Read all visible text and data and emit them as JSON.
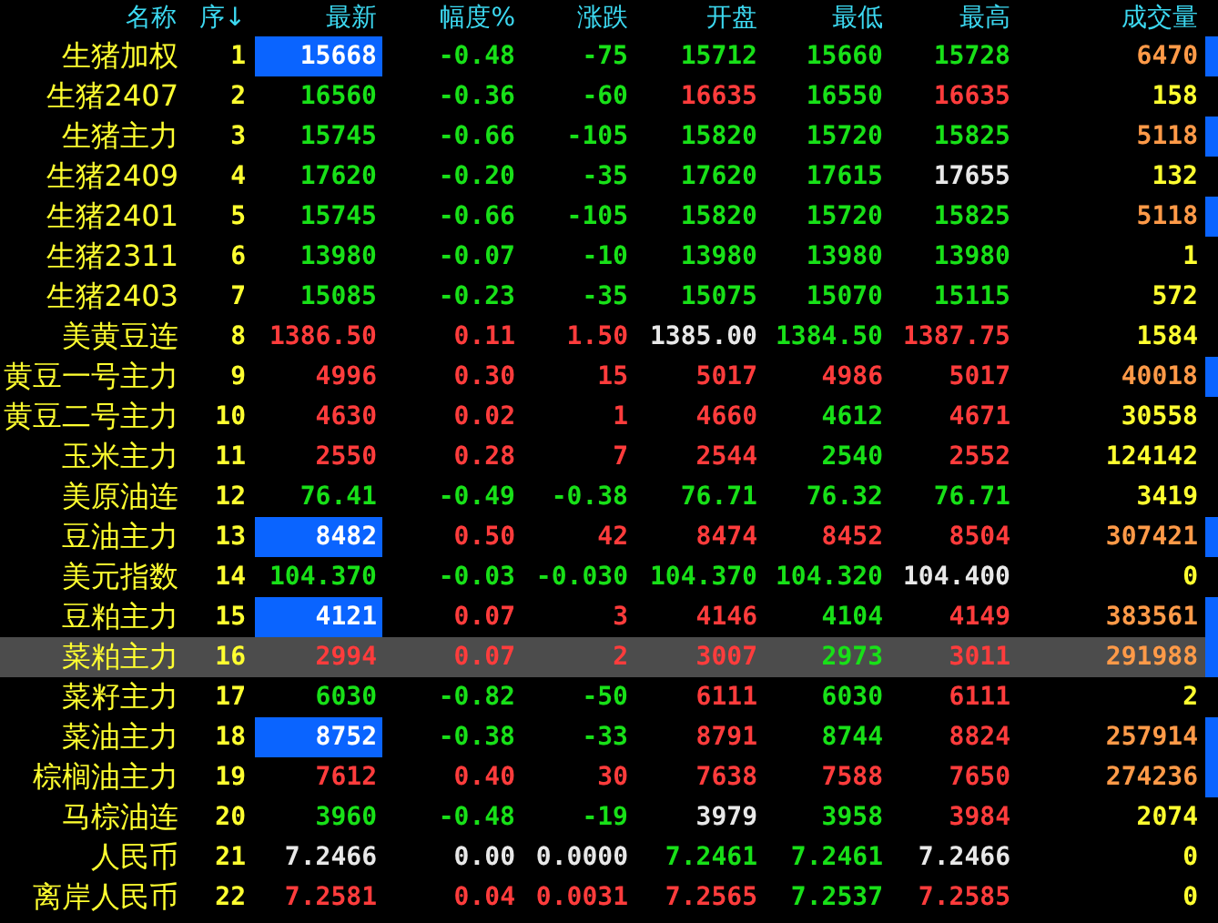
{
  "table": {
    "columns": [
      {
        "label": "名称"
      },
      {
        "label": "序↓"
      },
      {
        "label": "最新"
      },
      {
        "label": "幅度%"
      },
      {
        "label": "涨跌"
      },
      {
        "label": "开盘"
      },
      {
        "label": "最低"
      },
      {
        "label": "最高"
      },
      {
        "label": "成交量"
      }
    ],
    "rows": [
      {
        "selected": false,
        "highlighted": true,
        "marked": true,
        "cells": [
          {
            "text": "生猪加权",
            "color": "#ffff30"
          },
          {
            "text": "1",
            "color": "#ffff30"
          },
          {
            "text": "15668",
            "color": "#ffffff"
          },
          {
            "text": "-0.48",
            "color": "#18e018"
          },
          {
            "text": "-75",
            "color": "#18e018"
          },
          {
            "text": "15712",
            "color": "#18e018"
          },
          {
            "text": "15660",
            "color": "#18e018"
          },
          {
            "text": "15728",
            "color": "#18e018"
          },
          {
            "text": "6470",
            "color": "#ff9a48"
          }
        ]
      },
      {
        "selected": false,
        "highlighted": false,
        "marked": false,
        "cells": [
          {
            "text": "生猪2407",
            "color": "#ffff30"
          },
          {
            "text": "2",
            "color": "#ffff30"
          },
          {
            "text": "16560",
            "color": "#18e018"
          },
          {
            "text": "-0.36",
            "color": "#18e018"
          },
          {
            "text": "-60",
            "color": "#18e018"
          },
          {
            "text": "16635",
            "color": "#ff3c3c"
          },
          {
            "text": "16550",
            "color": "#18e018"
          },
          {
            "text": "16635",
            "color": "#ff3c3c"
          },
          {
            "text": "158",
            "color": "#ffff30"
          }
        ]
      },
      {
        "selected": false,
        "highlighted": false,
        "marked": true,
        "cells": [
          {
            "text": "生猪主力",
            "color": "#ffff30"
          },
          {
            "text": "3",
            "color": "#ffff30"
          },
          {
            "text": "15745",
            "color": "#18e018"
          },
          {
            "text": "-0.66",
            "color": "#18e018"
          },
          {
            "text": "-105",
            "color": "#18e018"
          },
          {
            "text": "15820",
            "color": "#18e018"
          },
          {
            "text": "15720",
            "color": "#18e018"
          },
          {
            "text": "15825",
            "color": "#18e018"
          },
          {
            "text": "5118",
            "color": "#ff9a48"
          }
        ]
      },
      {
        "selected": false,
        "highlighted": false,
        "marked": false,
        "cells": [
          {
            "text": "生猪2409",
            "color": "#ffff30"
          },
          {
            "text": "4",
            "color": "#ffff30"
          },
          {
            "text": "17620",
            "color": "#18e018"
          },
          {
            "text": "-0.20",
            "color": "#18e018"
          },
          {
            "text": "-35",
            "color": "#18e018"
          },
          {
            "text": "17620",
            "color": "#18e018"
          },
          {
            "text": "17615",
            "color": "#18e018"
          },
          {
            "text": "17655",
            "color": "#e8e8e8"
          },
          {
            "text": "132",
            "color": "#ffff30"
          }
        ]
      },
      {
        "selected": false,
        "highlighted": false,
        "marked": true,
        "cells": [
          {
            "text": "生猪2401",
            "color": "#ffff30"
          },
          {
            "text": "5",
            "color": "#ffff30"
          },
          {
            "text": "15745",
            "color": "#18e018"
          },
          {
            "text": "-0.66",
            "color": "#18e018"
          },
          {
            "text": "-105",
            "color": "#18e018"
          },
          {
            "text": "15820",
            "color": "#18e018"
          },
          {
            "text": "15720",
            "color": "#18e018"
          },
          {
            "text": "15825",
            "color": "#18e018"
          },
          {
            "text": "5118",
            "color": "#ff9a48"
          }
        ]
      },
      {
        "selected": false,
        "highlighted": false,
        "marked": false,
        "cells": [
          {
            "text": "生猪2311",
            "color": "#ffff30"
          },
          {
            "text": "6",
            "color": "#ffff30"
          },
          {
            "text": "13980",
            "color": "#18e018"
          },
          {
            "text": "-0.07",
            "color": "#18e018"
          },
          {
            "text": "-10",
            "color": "#18e018"
          },
          {
            "text": "13980",
            "color": "#18e018"
          },
          {
            "text": "13980",
            "color": "#18e018"
          },
          {
            "text": "13980",
            "color": "#18e018"
          },
          {
            "text": "1",
            "color": "#ffff30"
          }
        ]
      },
      {
        "selected": false,
        "highlighted": false,
        "marked": false,
        "cells": [
          {
            "text": "生猪2403",
            "color": "#ffff30"
          },
          {
            "text": "7",
            "color": "#ffff30"
          },
          {
            "text": "15085",
            "color": "#18e018"
          },
          {
            "text": "-0.23",
            "color": "#18e018"
          },
          {
            "text": "-35",
            "color": "#18e018"
          },
          {
            "text": "15075",
            "color": "#18e018"
          },
          {
            "text": "15070",
            "color": "#18e018"
          },
          {
            "text": "15115",
            "color": "#18e018"
          },
          {
            "text": "572",
            "color": "#ffff30"
          }
        ]
      },
      {
        "selected": false,
        "highlighted": false,
        "marked": false,
        "cells": [
          {
            "text": "美黄豆连",
            "color": "#ffff30"
          },
          {
            "text": "8",
            "color": "#ffff30"
          },
          {
            "text": "1386.50",
            "color": "#ff3c3c"
          },
          {
            "text": "0.11",
            "color": "#ff3c3c"
          },
          {
            "text": "1.50",
            "color": "#ff3c3c"
          },
          {
            "text": "1385.00",
            "color": "#e8e8e8"
          },
          {
            "text": "1384.50",
            "color": "#18e018"
          },
          {
            "text": "1387.75",
            "color": "#ff3c3c"
          },
          {
            "text": "1584",
            "color": "#ffff30"
          }
        ]
      },
      {
        "selected": false,
        "highlighted": false,
        "marked": true,
        "cells": [
          {
            "text": "黄豆一号主力",
            "color": "#ffff30"
          },
          {
            "text": "9",
            "color": "#ffff30"
          },
          {
            "text": "4996",
            "color": "#ff3c3c"
          },
          {
            "text": "0.30",
            "color": "#ff3c3c"
          },
          {
            "text": "15",
            "color": "#ff3c3c"
          },
          {
            "text": "5017",
            "color": "#ff3c3c"
          },
          {
            "text": "4986",
            "color": "#ff3c3c"
          },
          {
            "text": "5017",
            "color": "#ff3c3c"
          },
          {
            "text": "40018",
            "color": "#ff9a48"
          }
        ]
      },
      {
        "selected": false,
        "highlighted": false,
        "marked": false,
        "cells": [
          {
            "text": "黄豆二号主力",
            "color": "#ffff30"
          },
          {
            "text": "10",
            "color": "#ffff30"
          },
          {
            "text": "4630",
            "color": "#ff3c3c"
          },
          {
            "text": "0.02",
            "color": "#ff3c3c"
          },
          {
            "text": "1",
            "color": "#ff3c3c"
          },
          {
            "text": "4660",
            "color": "#ff3c3c"
          },
          {
            "text": "4612",
            "color": "#18e018"
          },
          {
            "text": "4671",
            "color": "#ff3c3c"
          },
          {
            "text": "30558",
            "color": "#ffff30"
          }
        ]
      },
      {
        "selected": false,
        "highlighted": false,
        "marked": false,
        "cells": [
          {
            "text": "玉米主力",
            "color": "#ffff30"
          },
          {
            "text": "11",
            "color": "#ffff30"
          },
          {
            "text": "2550",
            "color": "#ff3c3c"
          },
          {
            "text": "0.28",
            "color": "#ff3c3c"
          },
          {
            "text": "7",
            "color": "#ff3c3c"
          },
          {
            "text": "2544",
            "color": "#ff3c3c"
          },
          {
            "text": "2540",
            "color": "#18e018"
          },
          {
            "text": "2552",
            "color": "#ff3c3c"
          },
          {
            "text": "124142",
            "color": "#ffff30"
          }
        ]
      },
      {
        "selected": false,
        "highlighted": false,
        "marked": false,
        "cells": [
          {
            "text": "美原油连",
            "color": "#ffff30"
          },
          {
            "text": "12",
            "color": "#ffff30"
          },
          {
            "text": "76.41",
            "color": "#18e018"
          },
          {
            "text": "-0.49",
            "color": "#18e018"
          },
          {
            "text": "-0.38",
            "color": "#18e018"
          },
          {
            "text": "76.71",
            "color": "#18e018"
          },
          {
            "text": "76.32",
            "color": "#18e018"
          },
          {
            "text": "76.71",
            "color": "#18e018"
          },
          {
            "text": "3419",
            "color": "#ffff30"
          }
        ]
      },
      {
        "selected": false,
        "highlighted": true,
        "marked": true,
        "cells": [
          {
            "text": "豆油主力",
            "color": "#ffff30"
          },
          {
            "text": "13",
            "color": "#ffff30"
          },
          {
            "text": "8482",
            "color": "#ffffff"
          },
          {
            "text": "0.50",
            "color": "#ff3c3c"
          },
          {
            "text": "42",
            "color": "#ff3c3c"
          },
          {
            "text": "8474",
            "color": "#ff3c3c"
          },
          {
            "text": "8452",
            "color": "#ff3c3c"
          },
          {
            "text": "8504",
            "color": "#ff3c3c"
          },
          {
            "text": "307421",
            "color": "#ff9a48"
          }
        ]
      },
      {
        "selected": false,
        "highlighted": false,
        "marked": false,
        "cells": [
          {
            "text": "美元指数",
            "color": "#ffff30"
          },
          {
            "text": "14",
            "color": "#ffff30"
          },
          {
            "text": "104.370",
            "color": "#18e018"
          },
          {
            "text": "-0.03",
            "color": "#18e018"
          },
          {
            "text": "-0.030",
            "color": "#18e018"
          },
          {
            "text": "104.370",
            "color": "#18e018"
          },
          {
            "text": "104.320",
            "color": "#18e018"
          },
          {
            "text": "104.400",
            "color": "#e8e8e8"
          },
          {
            "text": "0",
            "color": "#ffff30"
          }
        ]
      },
      {
        "selected": false,
        "highlighted": true,
        "marked": true,
        "cells": [
          {
            "text": "豆粕主力",
            "color": "#ffff30"
          },
          {
            "text": "15",
            "color": "#ffff30"
          },
          {
            "text": "4121",
            "color": "#ffffff"
          },
          {
            "text": "0.07",
            "color": "#ff3c3c"
          },
          {
            "text": "3",
            "color": "#ff3c3c"
          },
          {
            "text": "4146",
            "color": "#ff3c3c"
          },
          {
            "text": "4104",
            "color": "#18e018"
          },
          {
            "text": "4149",
            "color": "#ff3c3c"
          },
          {
            "text": "383561",
            "color": "#ff9a48"
          }
        ]
      },
      {
        "selected": true,
        "highlighted": false,
        "marked": true,
        "cells": [
          {
            "text": "菜粕主力",
            "color": "#ffff30"
          },
          {
            "text": "16",
            "color": "#ffff30"
          },
          {
            "text": "2994",
            "color": "#ff3c3c"
          },
          {
            "text": "0.07",
            "color": "#ff3c3c"
          },
          {
            "text": "2",
            "color": "#ff3c3c"
          },
          {
            "text": "3007",
            "color": "#ff3c3c"
          },
          {
            "text": "2973",
            "color": "#18e018"
          },
          {
            "text": "3011",
            "color": "#ff3c3c"
          },
          {
            "text": "291988",
            "color": "#ff9a48"
          }
        ]
      },
      {
        "selected": false,
        "highlighted": false,
        "marked": false,
        "cells": [
          {
            "text": "菜籽主力",
            "color": "#ffff30"
          },
          {
            "text": "17",
            "color": "#ffff30"
          },
          {
            "text": "6030",
            "color": "#18e018"
          },
          {
            "text": "-0.82",
            "color": "#18e018"
          },
          {
            "text": "-50",
            "color": "#18e018"
          },
          {
            "text": "6111",
            "color": "#ff3c3c"
          },
          {
            "text": "6030",
            "color": "#18e018"
          },
          {
            "text": "6111",
            "color": "#ff3c3c"
          },
          {
            "text": "2",
            "color": "#ffff30"
          }
        ]
      },
      {
        "selected": false,
        "highlighted": true,
        "marked": true,
        "cells": [
          {
            "text": "菜油主力",
            "color": "#ffff30"
          },
          {
            "text": "18",
            "color": "#ffff30"
          },
          {
            "text": "8752",
            "color": "#ffffff"
          },
          {
            "text": "-0.38",
            "color": "#18e018"
          },
          {
            "text": "-33",
            "color": "#18e018"
          },
          {
            "text": "8791",
            "color": "#ff3c3c"
          },
          {
            "text": "8744",
            "color": "#18e018"
          },
          {
            "text": "8824",
            "color": "#ff3c3c"
          },
          {
            "text": "257914",
            "color": "#ff9a48"
          }
        ]
      },
      {
        "selected": false,
        "highlighted": false,
        "marked": true,
        "cells": [
          {
            "text": "棕榈油主力",
            "color": "#ffff30"
          },
          {
            "text": "19",
            "color": "#ffff30"
          },
          {
            "text": "7612",
            "color": "#ff3c3c"
          },
          {
            "text": "0.40",
            "color": "#ff3c3c"
          },
          {
            "text": "30",
            "color": "#ff3c3c"
          },
          {
            "text": "7638",
            "color": "#ff3c3c"
          },
          {
            "text": "7588",
            "color": "#ff3c3c"
          },
          {
            "text": "7650",
            "color": "#ff3c3c"
          },
          {
            "text": "274236",
            "color": "#ff9a48"
          }
        ]
      },
      {
        "selected": false,
        "highlighted": false,
        "marked": false,
        "cells": [
          {
            "text": "马棕油连",
            "color": "#ffff30"
          },
          {
            "text": "20",
            "color": "#ffff30"
          },
          {
            "text": "3960",
            "color": "#18e018"
          },
          {
            "text": "-0.48",
            "color": "#18e018"
          },
          {
            "text": "-19",
            "color": "#18e018"
          },
          {
            "text": "3979",
            "color": "#e8e8e8"
          },
          {
            "text": "3958",
            "color": "#18e018"
          },
          {
            "text": "3984",
            "color": "#ff3c3c"
          },
          {
            "text": "2074",
            "color": "#ffff30"
          }
        ]
      },
      {
        "selected": false,
        "highlighted": false,
        "marked": false,
        "cells": [
          {
            "text": "人民币",
            "color": "#ffff30"
          },
          {
            "text": "21",
            "color": "#ffff30"
          },
          {
            "text": "7.2466",
            "color": "#e8e8e8"
          },
          {
            "text": "0.00",
            "color": "#e8e8e8"
          },
          {
            "text": "0.0000",
            "color": "#e8e8e8"
          },
          {
            "text": "7.2461",
            "color": "#18e018"
          },
          {
            "text": "7.2461",
            "color": "#18e018"
          },
          {
            "text": "7.2466",
            "color": "#e8e8e8"
          },
          {
            "text": "0",
            "color": "#ffff30"
          }
        ]
      },
      {
        "selected": false,
        "highlighted": false,
        "marked": false,
        "cells": [
          {
            "text": "离岸人民币",
            "color": "#ffff30"
          },
          {
            "text": "22",
            "color": "#ffff30"
          },
          {
            "text": "7.2581",
            "color": "#ff3c3c"
          },
          {
            "text": "0.04",
            "color": "#ff3c3c"
          },
          {
            "text": "0.0031",
            "color": "#ff3c3c"
          },
          {
            "text": "7.2565",
            "color": "#ff3c3c"
          },
          {
            "text": "7.2537",
            "color": "#18e018"
          },
          {
            "text": "7.2585",
            "color": "#ff3c3c"
          },
          {
            "text": "0",
            "color": "#ffff30"
          }
        ]
      }
    ]
  }
}
